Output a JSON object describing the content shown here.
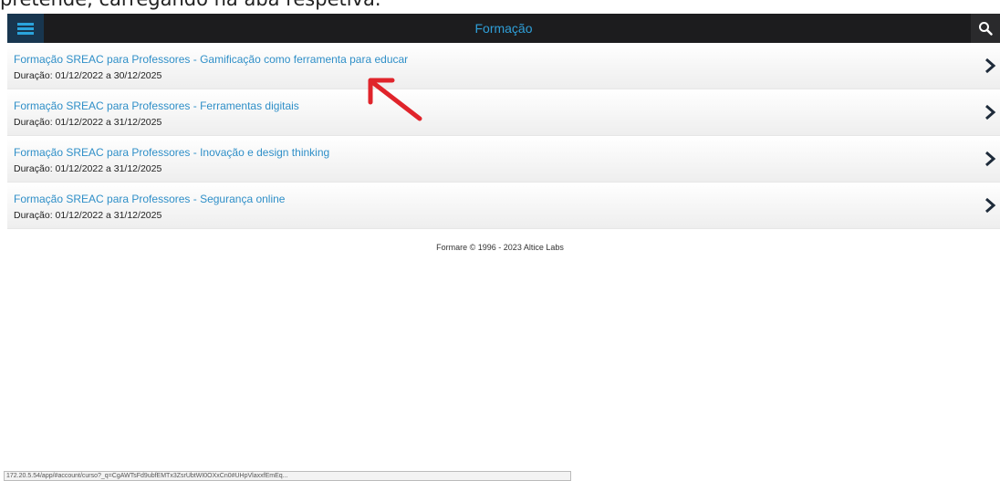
{
  "caption": "pretende, carregando na aba respetiva.",
  "nav": {
    "title": "Formação",
    "menu_icon": "hamburger-menu-icon",
    "search_icon": "search-icon",
    "accent": "#2f9fd8"
  },
  "courses": [
    {
      "title": "Formação SREAC para Professores - Gamificação como ferramenta para educar",
      "duration": "Duração: 01/12/2022 a 30/12/2025"
    },
    {
      "title": "Formação SREAC para Professores - Ferramentas digitais",
      "duration": "Duração: 01/12/2022 a 31/12/2025"
    },
    {
      "title": "Formação SREAC para Professores - Inovação e design thinking",
      "duration": "Duração: 01/12/2022 a 31/12/2025"
    },
    {
      "title": "Formação SREAC para Professores - Segurança online",
      "duration": "Duração: 01/12/2022 a 31/12/2025"
    }
  ],
  "footer": "Formare © 1996 - 2023 Altice Labs",
  "status_url": "172.20.5.54/app/#account/curso?_q=CgAWTsFd9ubfEMTx3ZsrUbtWI0OXxCn0#UHpVlaxxfEmEq..."
}
